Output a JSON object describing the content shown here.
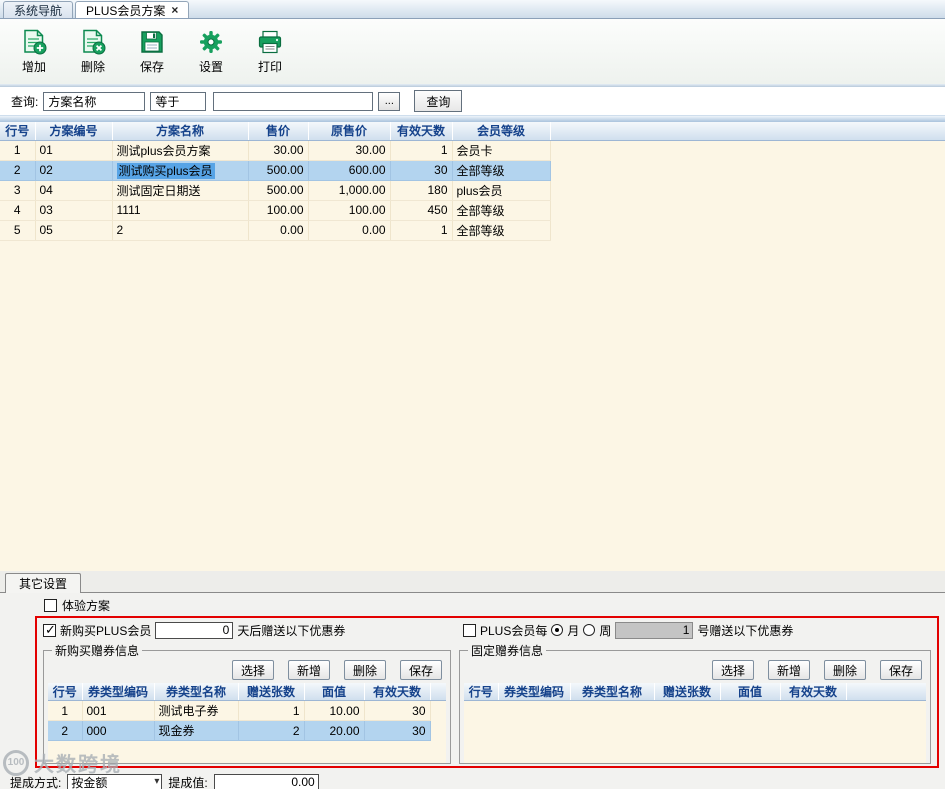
{
  "tabbar": {
    "tabs": [
      {
        "label": "系统导航"
      },
      {
        "label": "PLUS会员方案"
      }
    ],
    "close_glyph": "×"
  },
  "toolbar": {
    "add": "增加",
    "remove": "删除",
    "save": "保存",
    "settings": "设置",
    "print": "打印"
  },
  "query": {
    "label": "查询:",
    "field": "方案名称",
    "operator": "等于",
    "keyword": "",
    "browse": "...",
    "search": "查询"
  },
  "plan_grid": {
    "columns": [
      "行号",
      "方案编号",
      "方案名称",
      "售价",
      "原售价",
      "有效天数",
      "会员等级"
    ],
    "rows": [
      [
        "1",
        "01",
        "测试plus会员方案",
        "30.00",
        "30.00",
        "1",
        "会员卡"
      ],
      [
        "2",
        "02",
        "测试购买plus会员",
        "500.00",
        "600.00",
        "30",
        "全部等级"
      ],
      [
        "3",
        "04",
        "测试固定日期送",
        "500.00",
        "1,000.00",
        "180",
        "plus会员"
      ],
      [
        "4",
        "03",
        "1111",
        "100.00",
        "100.00",
        "450",
        "全部等级"
      ],
      [
        "5",
        "05",
        "2",
        "0.00",
        "0.00",
        "1",
        "全部等级"
      ]
    ],
    "selected_row": 1,
    "selected_cell": 2
  },
  "other_settings": {
    "tab_label": "其它设置",
    "trial": {
      "label": "体验方案",
      "checked": false
    },
    "new_purchase": {
      "label": "新购买PLUS会员",
      "checked": true,
      "days": "0",
      "suffix": "天后赠送以下优惠券"
    },
    "periodic": {
      "label": "PLUS会员每",
      "checked": false,
      "month": "月",
      "month_selected": true,
      "week": "周",
      "week_selected": false,
      "day": "1",
      "suffix": "号赠送以下优惠券"
    },
    "new_purchase_coupons": {
      "title": "新购买赠券信息",
      "buttons": {
        "select": "选择",
        "add": "新增",
        "remove": "删除",
        "save": "保存"
      },
      "columns": [
        "行号",
        "券类型编码",
        "券类型名称",
        "赠送张数",
        "面值",
        "有效天数"
      ],
      "rows": [
        [
          "1",
          "001",
          "测试电子券",
          "1",
          "10.00",
          "30"
        ],
        [
          "2",
          "000",
          "现金券",
          "2",
          "20.00",
          "30"
        ]
      ],
      "selected_row": 1
    },
    "fixed_coupons": {
      "title": "固定赠券信息",
      "buttons": {
        "select": "选择",
        "add": "新增",
        "remove": "删除",
        "save": "保存"
      },
      "columns": [
        "行号",
        "券类型编码",
        "券类型名称",
        "赠送张数",
        "面值",
        "有效天数"
      ],
      "rows": []
    },
    "footer": {
      "method_label": "提成方式:",
      "method_value": "按金额",
      "value_label": "提成值:",
      "value": "0.00"
    }
  },
  "watermark": {
    "badge": "100",
    "text": "大数跨境"
  }
}
